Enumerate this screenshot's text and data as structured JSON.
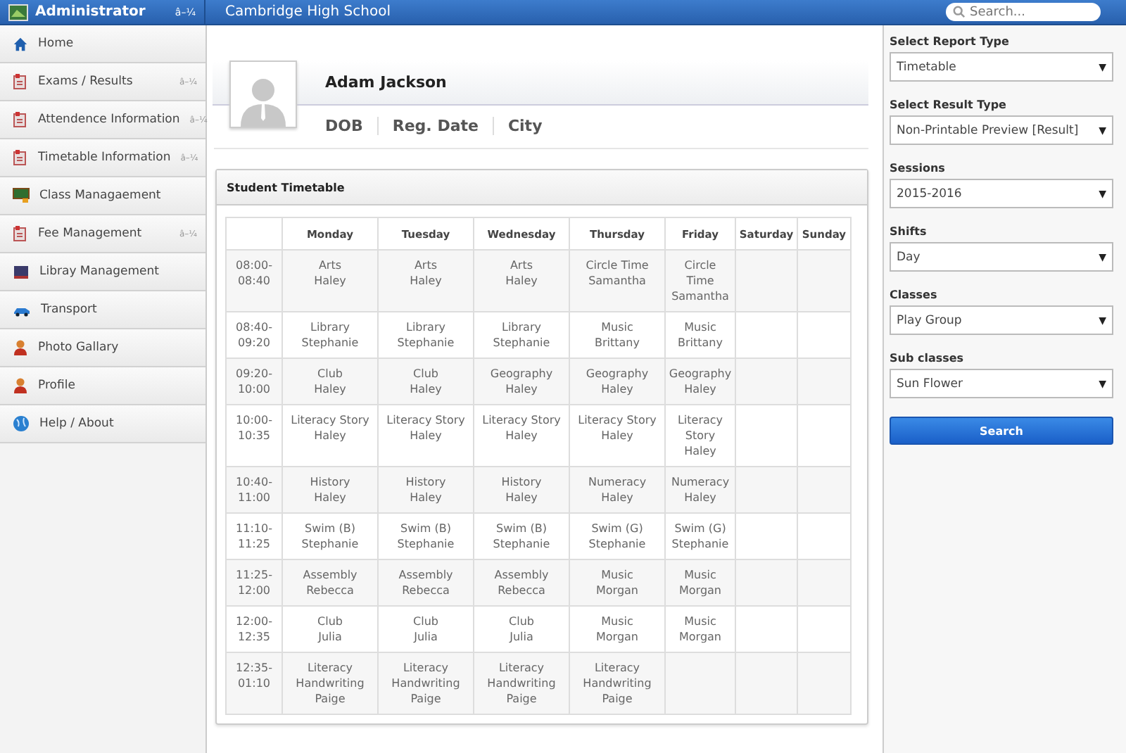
{
  "topbar": {
    "user": "Administrator",
    "user_caret": "â–¼",
    "school": "Cambridge High School",
    "search": {
      "placeholder": "Search..."
    }
  },
  "sidebar": {
    "items": [
      {
        "label": "Home",
        "kind": "home",
        "selected": false
      },
      {
        "label": "Exams / Results",
        "kind": "doc",
        "caret": "â–¼",
        "selected": false
      },
      {
        "label": "Attendence Information",
        "kind": "doc",
        "caret": "â–¼",
        "selected": false
      },
      {
        "label": "Timetable Information",
        "kind": "doc",
        "caret": "â–¼",
        "selected": false
      },
      {
        "label": "Class Managaement",
        "kind": "board",
        "selected": false
      },
      {
        "label": "Fee Management",
        "kind": "doc",
        "caret": "â–¼",
        "selected": false
      },
      {
        "label": "Libray Management",
        "kind": "book",
        "selected": false
      },
      {
        "label": "Transport",
        "kind": "car",
        "selected": false
      },
      {
        "label": "Photo Gallary",
        "kind": "person",
        "selected": false
      },
      {
        "label": "Profile",
        "kind": "person",
        "selected": false
      },
      {
        "label": "Help / About",
        "kind": "globe",
        "selected": false
      }
    ]
  },
  "profile": {
    "name": "Adam Jackson",
    "fields": [
      "DOB",
      "Reg. Date",
      "City"
    ]
  },
  "timetable": {
    "title": "Student Timetable",
    "columns": [
      "Monday",
      "Tuesday",
      "Wednesday",
      "Thursday",
      "Friday",
      "Saturday",
      "Sunday"
    ],
    "rows": [
      {
        "time": "08:00-\n08:40",
        "cells": [
          "Arts\nHaley",
          "Arts\nHaley",
          "Arts\nHaley",
          "Circle Time\nSamantha",
          "Circle\nTime\nSamantha"
        ]
      },
      {
        "time": "08:40-\n09:20",
        "cells": [
          "Library\nStephanie",
          "Library\nStephanie",
          "Library\nStephanie",
          "Music\nBrittany",
          "Music\nBrittany"
        ]
      },
      {
        "time": "09:20-\n10:00",
        "cells": [
          "Club\nHaley",
          "Club\nHaley",
          "Geography\nHaley",
          "Geography\nHaley",
          "Geography\nHaley"
        ]
      },
      {
        "time": "10:00-\n10:35",
        "cells": [
          "Literacy Story\nHaley",
          "Literacy Story\nHaley",
          "Literacy Story\nHaley",
          "Literacy Story\nHaley",
          "Literacy\nStory\nHaley"
        ]
      },
      {
        "time": "10:40-\n11:00",
        "cells": [
          "History\nHaley",
          "History\nHaley",
          "History\nHaley",
          "Numeracy\nHaley",
          "Numeracy\nHaley"
        ]
      },
      {
        "time": "11:10-\n11:25",
        "cells": [
          "Swim (B)\nStephanie",
          "Swim (B)\nStephanie",
          "Swim (B)\nStephanie",
          "Swim (G)\nStephanie",
          "Swim (G)\nStephanie"
        ]
      },
      {
        "time": "11:25-\n12:00",
        "cells": [
          "Assembly\nRebecca",
          "Assembly\nRebecca",
          "Assembly\nRebecca",
          "Music\nMorgan",
          "Music\nMorgan"
        ]
      },
      {
        "time": "12:00-\n12:35",
        "cells": [
          "Club\nJulia",
          "Club\nJulia",
          "Club\nJulia",
          "Music\nMorgan",
          "Music\nMorgan"
        ]
      },
      {
        "time": "12:35-\n01:10",
        "cells": [
          "Literacy\nHandwriting\nPaige",
          "Literacy\nHandwriting\nPaige",
          "Literacy\nHandwriting\nPaige",
          "Literacy\nHandwriting\nPaige"
        ]
      }
    ]
  },
  "filters": [
    {
      "label": "Select Report Type",
      "value": "Timetable",
      "caret": "▼"
    },
    {
      "label": "Select Result Type",
      "value": "Non-Printable Preview [Result]",
      "caret": "▼"
    },
    {
      "label": "Sessions",
      "value": "2015-2016",
      "caret": "▼"
    },
    {
      "label": "Shifts",
      "value": "Day",
      "caret": "▼"
    },
    {
      "label": "Classes",
      "value": "Play Group",
      "caret": "▼"
    },
    {
      "label": "Sub classes",
      "value": "Sun Flower",
      "caret": "▼"
    }
  ],
  "search_button": "Search"
}
